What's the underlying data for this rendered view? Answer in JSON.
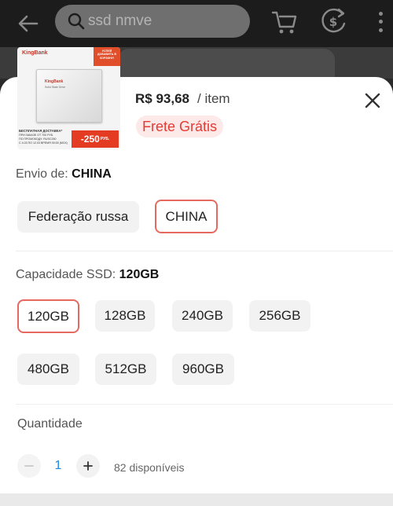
{
  "topbar": {
    "search_text": "ssd nmve",
    "icons": [
      "back-arrow-icon",
      "search-icon",
      "cart-icon",
      "coin-icon",
      "more-icon"
    ]
  },
  "product_image": {
    "brand": "KingBank",
    "corner_text": "УСПЕЙ ДОБАВИТЬ В КОРЗИНУ!",
    "ssd_brand": "KingBank",
    "ssd_subtitle": "Solid State Drive",
    "note_title": "БЕСПЛАТНАЯ ДОСТАВКА*",
    "note_line1": "ПРИ ЗАКАЗЕ ОТ 700 РУБ.",
    "note_line2": "ПО ПРОМОКОДУ: RUSC250",
    "note_line3": "С 4.03 ПО 12.03 ВРЕМЯ 00:00 (МСК)",
    "badge_value": "-250",
    "badge_unit": "РУБ."
  },
  "price": {
    "amount": "R$ 93,68",
    "per_item": "/ item"
  },
  "free_shipping": "Frete Grátis",
  "shipping": {
    "label": "Envio de: ",
    "value": "CHINA",
    "options": [
      {
        "label": "Federação russa",
        "selected": false
      },
      {
        "label": "CHINA",
        "selected": true
      }
    ]
  },
  "capacity": {
    "label": "Capacidade SSD: ",
    "value": "120GB",
    "options": [
      {
        "label": "120GB",
        "selected": true
      },
      {
        "label": "128GB",
        "selected": false
      },
      {
        "label": "240GB",
        "selected": false
      },
      {
        "label": "256GB",
        "selected": false
      },
      {
        "label": "480GB",
        "selected": false
      },
      {
        "label": "512GB",
        "selected": false
      },
      {
        "label": "960GB",
        "selected": false
      }
    ]
  },
  "quantity": {
    "label": "Quantidade",
    "value": "1",
    "available": "82 disponíveis"
  },
  "colors": {
    "accent": "#e53b35",
    "selected_border": "#e5695f",
    "qty_value": "#1e88e5"
  }
}
